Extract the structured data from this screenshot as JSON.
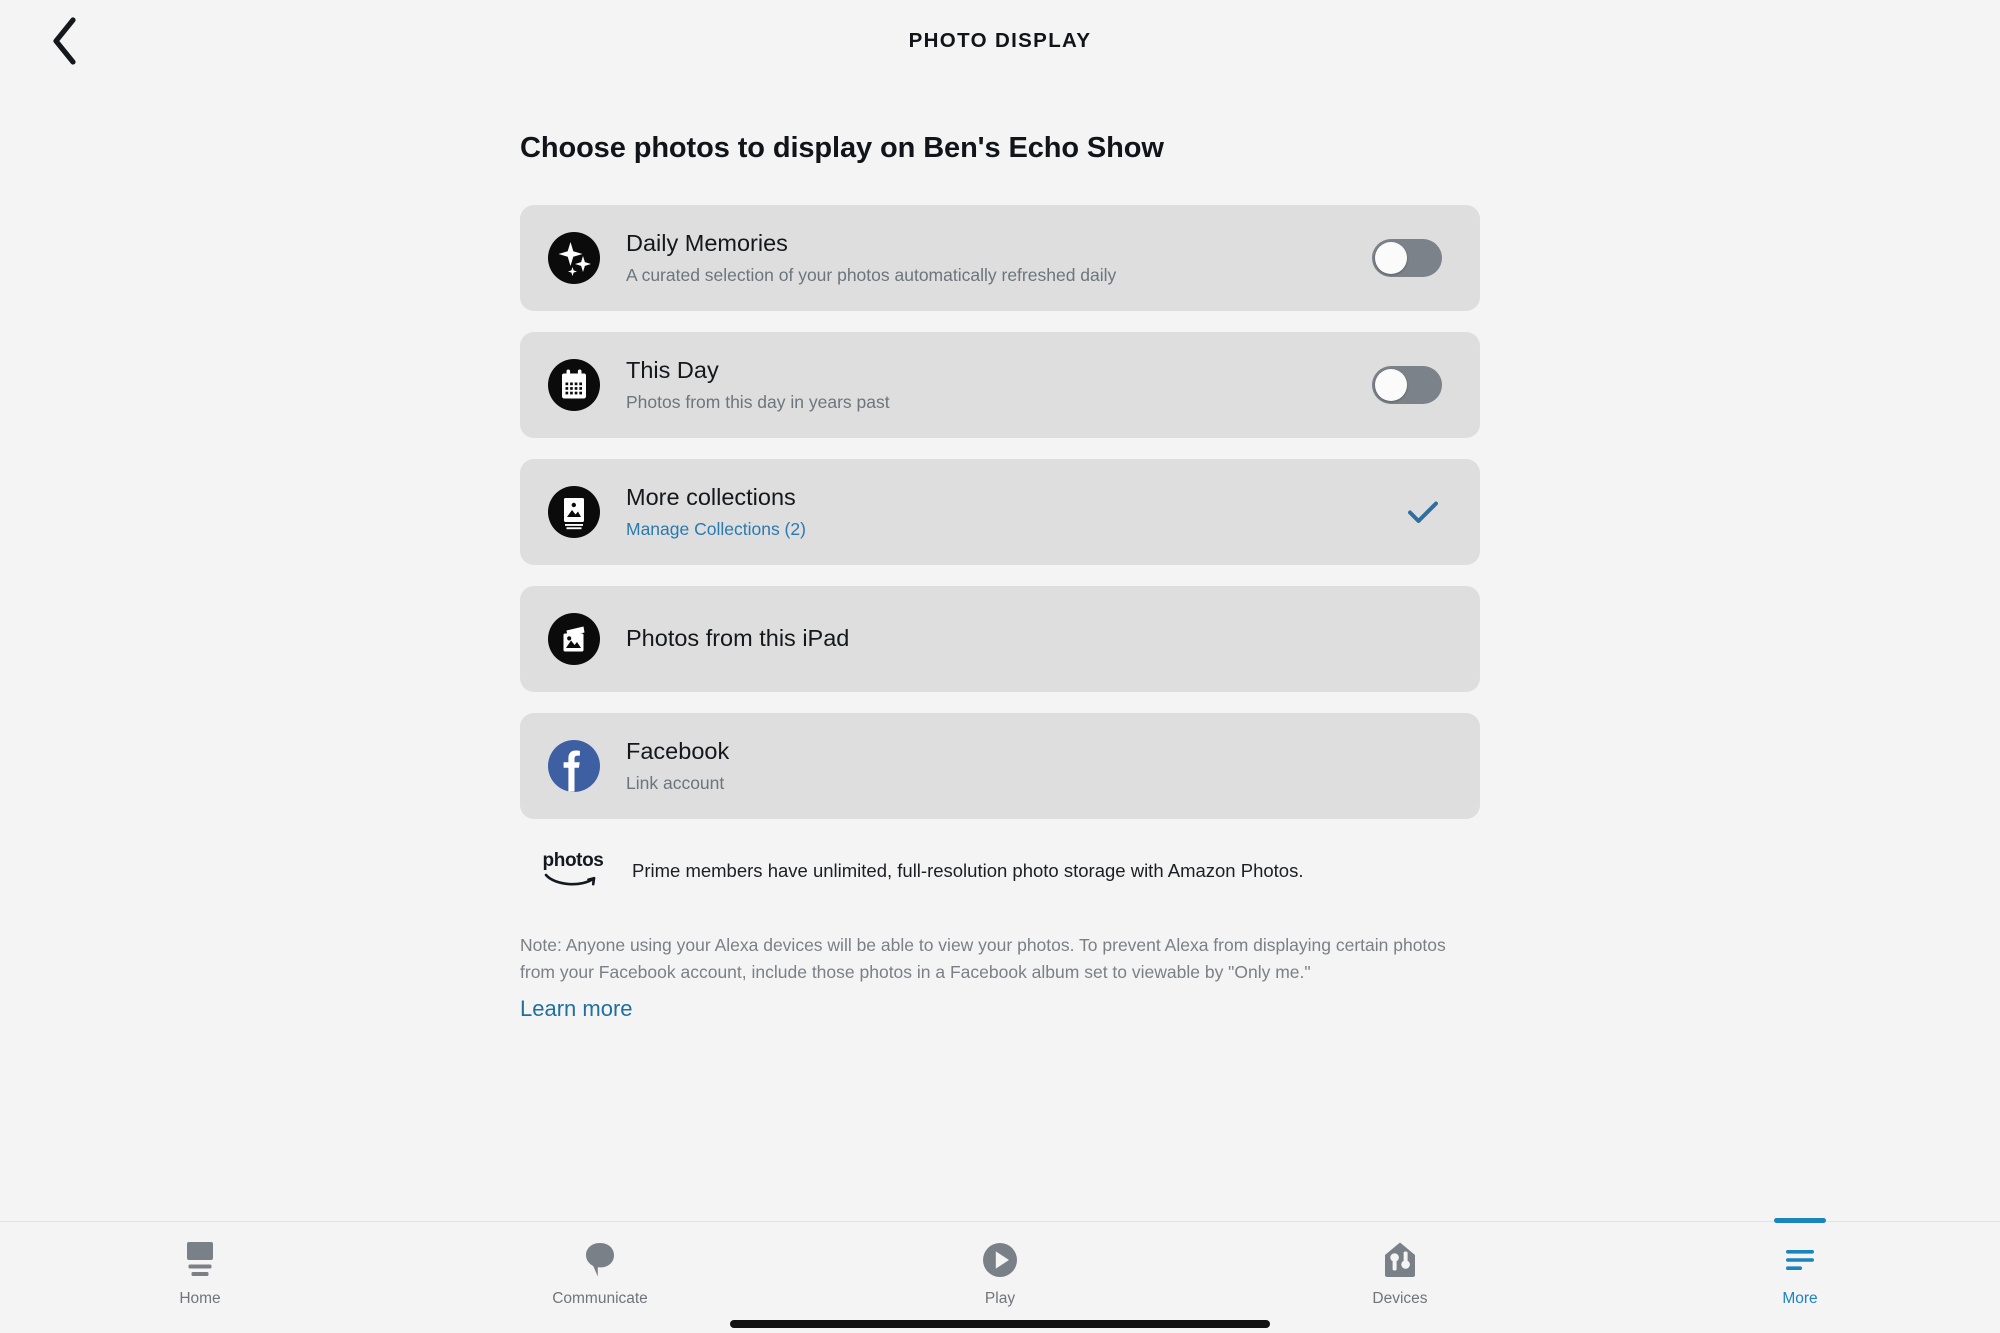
{
  "header": {
    "back_icon": "chevron-left-icon",
    "title": "PHOTO DISPLAY"
  },
  "main": {
    "heading": "Choose photos to display on Ben's Echo Show",
    "cards": [
      {
        "id": "daily-memories",
        "icon": "sparkle-icon",
        "title": "Daily Memories",
        "subtitle": "A curated selection of your photos automatically refreshed daily",
        "control": "toggle",
        "toggle_state": "off"
      },
      {
        "id": "this-day",
        "icon": "calendar-icon",
        "title": "This Day",
        "subtitle": "Photos from this day in years past",
        "control": "toggle",
        "toggle_state": "off"
      },
      {
        "id": "more-collections",
        "icon": "photo-album-icon",
        "title": "More collections",
        "subtitle": "Manage Collections (2)",
        "subtitle_is_link": true,
        "control": "check",
        "checked": true
      },
      {
        "id": "photos-from-this-ipad",
        "icon": "photo-stack-icon",
        "title": "Photos from this iPad",
        "subtitle": "",
        "control": "none"
      },
      {
        "id": "facebook",
        "icon": "facebook-icon",
        "title": "Facebook",
        "subtitle": "Link account",
        "control": "none"
      }
    ],
    "prime_note": {
      "logo_word": "photos",
      "logo_icon": "amazon-smile-icon",
      "text": "Prime members have unlimited, full-resolution photo storage with Amazon Photos."
    },
    "footnote": {
      "text": "Note: Anyone using your Alexa devices will be able to view your photos. To prevent Alexa from displaying certain photos from your Facebook account, include those photos in a Facebook album set to viewable by \"Only me.\"",
      "learn_more": "Learn more"
    }
  },
  "tabbar": {
    "items": [
      {
        "id": "home",
        "label": "Home",
        "icon": "echo-show-icon",
        "active": false
      },
      {
        "id": "communicate",
        "label": "Communicate",
        "icon": "speech-bubble-icon",
        "active": false
      },
      {
        "id": "play",
        "label": "Play",
        "icon": "play-circle-icon",
        "active": false
      },
      {
        "id": "devices",
        "label": "Devices",
        "icon": "smart-home-icon",
        "active": false
      },
      {
        "id": "more",
        "label": "More",
        "icon": "hamburger-menu-icon",
        "active": true
      }
    ]
  },
  "colors": {
    "page_background": "#f4f4f4",
    "card_background": "#dedede",
    "accent_blue": "#1b84bd",
    "link_blue": "#2a7ab0",
    "check_blue": "#2e6f9e",
    "facebook_blue": "#3f5fa3",
    "toggle_off_track": "#7c8289",
    "muted_text": "#6c757d"
  }
}
